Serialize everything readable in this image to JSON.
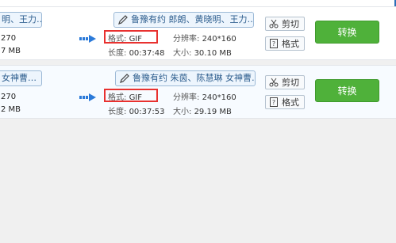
{
  "rows": [
    {
      "source_title": "明、王力…",
      "source_res_partial": "270",
      "source_size_partial": "7 MB",
      "output_title": "鲁豫有约 郎朗、黄晓明、王力…",
      "format_label": "格式:",
      "format_value": "GIF",
      "resolution_label": "分辨率:",
      "resolution_value": "240*160",
      "duration_label": "长度:",
      "duration_value": "00:37:48",
      "size_label": "大小:",
      "size_value": "30.10 MB",
      "cut_label": "剪切",
      "format_button_label": "格式",
      "convert_label": "转换"
    },
    {
      "source_title": "女神曹…",
      "source_res_partial": "270",
      "source_size_partial": "2 MB",
      "output_title": "鲁豫有约 朱茵、陈慧琳 女神曹…",
      "format_label": "格式:",
      "format_value": "GIF",
      "resolution_label": "分辨率:",
      "resolution_value": "240*160",
      "duration_label": "长度:",
      "duration_value": "00:37:53",
      "size_label": "大小:",
      "size_value": "29.19 MB",
      "cut_label": "剪切",
      "format_button_label": "格式",
      "convert_label": "转换"
    }
  ],
  "colors": {
    "accent_blue": "#2b7ad9",
    "convert_green": "#4fb13a",
    "highlight_red": "#e8312f"
  }
}
